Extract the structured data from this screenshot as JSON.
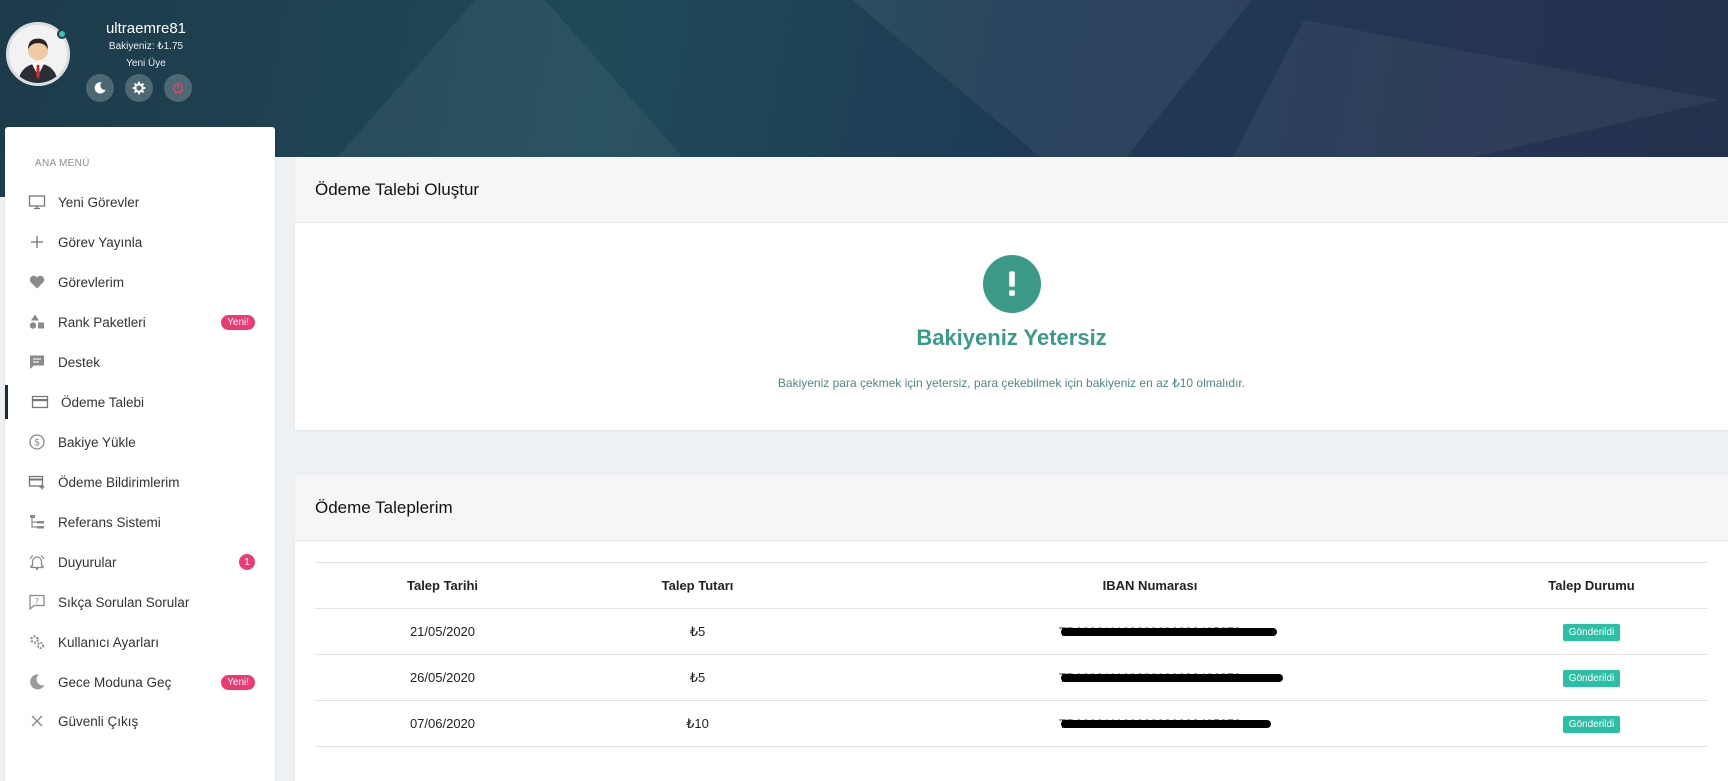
{
  "profile": {
    "username": "ultraemre81",
    "balance": "Bakiyeniz: ₺1.75",
    "rank": "Yeni Üye",
    "buttons": [
      {
        "name": "moon-icon"
      },
      {
        "name": "gear-icon"
      },
      {
        "name": "power-icon"
      }
    ]
  },
  "sidebar": {
    "heading": "ANA MENÜ",
    "items": [
      {
        "label": "Yeni Görevler",
        "icon": "monitor-icon"
      },
      {
        "label": "Görev Yayınla",
        "icon": "plus-icon"
      },
      {
        "label": "Görevlerim",
        "icon": "heart-icon"
      },
      {
        "label": "Rank Paketleri",
        "icon": "shapes-icon",
        "badge": "Yeni!"
      },
      {
        "label": "Destek",
        "icon": "chat-icon"
      },
      {
        "label": "Ödeme Talebi",
        "icon": "credit-card-icon",
        "active": true
      },
      {
        "label": "Bakiye Yükle",
        "icon": "dollar-circle-icon"
      },
      {
        "label": "Ödeme Bildirimlerim",
        "icon": "card-add-icon"
      },
      {
        "label": "Referans Sistemi",
        "icon": "tree-icon"
      },
      {
        "label": "Duyurular",
        "icon": "bell-icon",
        "badge": "1"
      },
      {
        "label": "Sıkça Sorulan Sorular",
        "icon": "question-icon"
      },
      {
        "label": "Kullanıcı Ayarları",
        "icon": "gears-icon"
      },
      {
        "label": "Gece Moduna Geç",
        "icon": "moon-icon",
        "badge": "Yeni!"
      },
      {
        "label": "Güvenli Çıkış",
        "icon": "close-icon"
      }
    ]
  },
  "create_card": {
    "title": "Ödeme Talebi Oluştur",
    "alert_title": "Bakiyeniz Yetersiz",
    "alert_text": "Bakiyeniz para çekmek için yetersiz, para çekebilmek için bakiyeniz en az ₺10 olmalıdır."
  },
  "requests_card": {
    "title": "Ödeme Taleplerim",
    "columns": [
      "Talep Tarihi",
      "Talep Tutarı",
      "IBAN Numarası",
      "Talep Durumu"
    ],
    "rows": [
      {
        "date": "21/05/2020",
        "amount": "₺5",
        "iban": "TR000011100000000002435876",
        "status": "Gönderildi"
      },
      {
        "date": "26/05/2020",
        "amount": "₺5",
        "iban": "TR000011100000000092426879",
        "status": "Gönderildi"
      },
      {
        "date": "07/06/2020",
        "amount": "₺10",
        "iban": "TR000011100000000002435876",
        "status": "Gönderildi"
      }
    ]
  },
  "colors": {
    "accent_teal": "#3c9a89",
    "badge_pink": "#ec3b73",
    "status_green": "#2bbfa6",
    "hero_dark": "#1f3c4f"
  }
}
